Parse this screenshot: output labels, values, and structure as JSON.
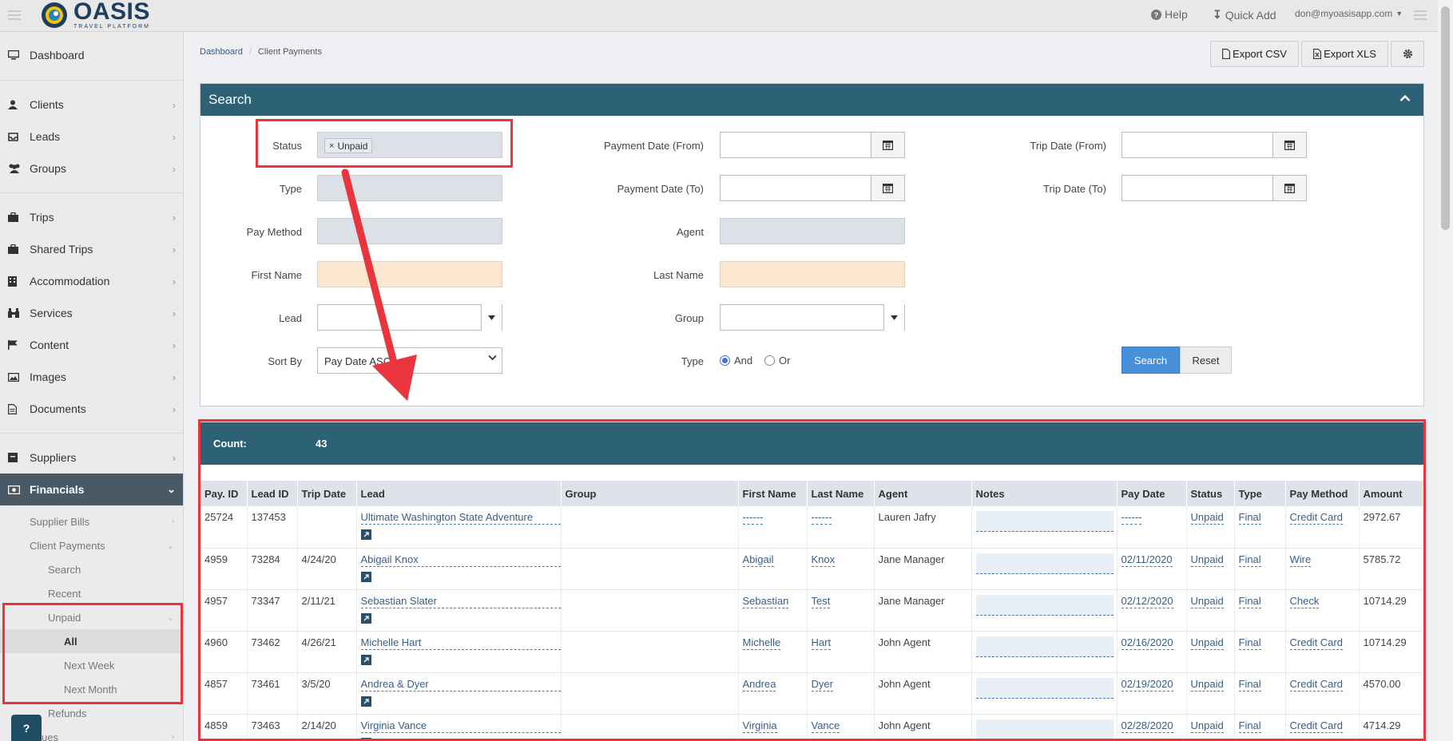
{
  "brand": {
    "name": "OASIS",
    "sub": "TRAVEL PLATFORM"
  },
  "topbar": {
    "help": "Help",
    "quick_add": "Quick Add",
    "user": "don@myoasisapp.com"
  },
  "sidebar": {
    "items": [
      {
        "label": "Dashboard",
        "icon": "monitor-icon"
      },
      {
        "label": "Clients",
        "icon": "user-icon"
      },
      {
        "label": "Leads",
        "icon": "inbox-icon"
      },
      {
        "label": "Groups",
        "icon": "users-icon"
      },
      {
        "label": "Trips",
        "icon": "briefcase-icon"
      },
      {
        "label": "Shared Trips",
        "icon": "briefcase-icon"
      },
      {
        "label": "Accommodation",
        "icon": "building-icon"
      },
      {
        "label": "Services",
        "icon": "binoculars-icon"
      },
      {
        "label": "Content",
        "icon": "flag-icon"
      },
      {
        "label": "Images",
        "icon": "image-icon"
      },
      {
        "label": "Documents",
        "icon": "file-icon"
      },
      {
        "label": "Suppliers",
        "icon": "archive-icon"
      },
      {
        "label": "Financials",
        "icon": "money-icon"
      }
    ],
    "financials_sub": [
      "Supplier Bills",
      "Client Payments"
    ],
    "client_payments_sub": [
      "Search",
      "Recent",
      "Unpaid"
    ],
    "unpaid_sub": [
      "All",
      "Next Week",
      "Next Month"
    ],
    "refunds": "Refunds",
    "partial": "ues",
    "help_button": "?"
  },
  "breadcrumb": {
    "home": "Dashboard",
    "current": "Client Payments"
  },
  "toolbar": {
    "export_csv": "Export CSV",
    "export_xls": "Export XLS"
  },
  "search": {
    "title": "Search",
    "status_label": "Status",
    "status_tag": "Unpaid",
    "type_label": "Type",
    "pay_method_label": "Pay Method",
    "first_name_label": "First Name",
    "lead_label": "Lead",
    "sort_by_label": "Sort By",
    "sort_by_value": "Pay Date ASC",
    "payment_date_from_label": "Payment Date (From)",
    "payment_date_to_label": "Payment Date (To)",
    "agent_label": "Agent",
    "last_name_label": "Last Name",
    "group_label": "Group",
    "type2_label": "Type",
    "radio_and": "And",
    "radio_or": "Or",
    "trip_date_from_label": "Trip Date (From)",
    "trip_date_to_label": "Trip Date (To)",
    "search_button": "Search",
    "reset_button": "Reset"
  },
  "results": {
    "count_label": "Count:",
    "count_value": "43",
    "columns": [
      "Pay. ID",
      "Lead ID",
      "Trip Date",
      "Lead",
      "Group",
      "First Name",
      "Last Name",
      "Agent",
      "Notes",
      "Pay Date",
      "Status",
      "Type",
      "Pay Method",
      "Amount"
    ],
    "rows": [
      {
        "pay_id": "25724",
        "lead_id": "137453",
        "trip_date": "",
        "lead": "Ultimate Washington State Adventure",
        "group": "",
        "first_name": "------",
        "last_name": "------",
        "agent": "Lauren Jafry",
        "pay_date": "------",
        "status": "Unpaid",
        "type": "Final",
        "pay_method": "Credit Card",
        "amount": "2972.67"
      },
      {
        "pay_id": "4959",
        "lead_id": "73284",
        "trip_date": "4/24/20",
        "lead": "Abigail Knox",
        "group": "",
        "first_name": "Abigail",
        "last_name": "Knox",
        "agent": "Jane Manager",
        "pay_date": "02/11/2020",
        "status": "Unpaid",
        "type": "Final",
        "pay_method": "Wire",
        "amount": "5785.72"
      },
      {
        "pay_id": "4957",
        "lead_id": "73347",
        "trip_date": "2/11/21",
        "lead": "Sebastian Slater",
        "group": "",
        "first_name": "Sebastian",
        "last_name": "Test",
        "agent": "Jane Manager",
        "pay_date": "02/12/2020",
        "status": "Unpaid",
        "type": "Final",
        "pay_method": "Check",
        "amount": "10714.29"
      },
      {
        "pay_id": "4960",
        "lead_id": "73462",
        "trip_date": "4/26/21",
        "lead": "Michelle Hart",
        "group": "",
        "first_name": "Michelle",
        "last_name": "Hart",
        "agent": "John Agent",
        "pay_date": "02/16/2020",
        "status": "Unpaid",
        "type": "Final",
        "pay_method": "Credit Card",
        "amount": "10714.29"
      },
      {
        "pay_id": "4857",
        "lead_id": "73461",
        "trip_date": "3/5/20",
        "lead": "Andrea & Dyer",
        "group": "",
        "first_name": "Andrea",
        "last_name": "Dyer",
        "agent": "John Agent",
        "pay_date": "02/19/2020",
        "status": "Unpaid",
        "type": "Final",
        "pay_method": "Credit Card",
        "amount": "4570.00"
      },
      {
        "pay_id": "4859",
        "lead_id": "73463",
        "trip_date": "2/14/20",
        "lead": "Virginia Vance",
        "group": "",
        "first_name": "Virginia",
        "last_name": "Vance",
        "agent": "John Agent",
        "pay_date": "02/28/2020",
        "status": "Unpaid",
        "type": "Final",
        "pay_method": "Credit Card",
        "amount": "4714.29"
      }
    ]
  },
  "colors": {
    "header": "#2d6276",
    "highlight": "#e8353e",
    "link": "#3a5d86",
    "primary": "#4a90d9"
  }
}
